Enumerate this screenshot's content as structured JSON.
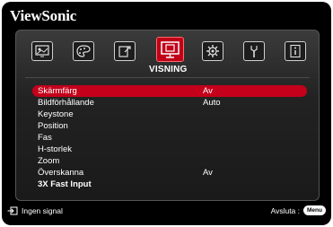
{
  "brand": "ViewSonic",
  "tabs": [
    {
      "name": "tab-display",
      "icon": "display-image-icon"
    },
    {
      "name": "tab-picture",
      "icon": "color-palette-icon"
    },
    {
      "name": "tab-source",
      "icon": "source-input-icon"
    },
    {
      "name": "tab-visning",
      "icon": "projector-screen-icon",
      "active": true,
      "label": "VISNING"
    },
    {
      "name": "tab-settings",
      "icon": "gear-icon"
    },
    {
      "name": "tab-advanced",
      "icon": "tools-icon"
    },
    {
      "name": "tab-info",
      "icon": "info-icon"
    }
  ],
  "active_tab_label": "VISNING",
  "menu": {
    "items": [
      {
        "label": "Skärmfärg",
        "value": "Av",
        "selected": true
      },
      {
        "label": "Bildförhållande",
        "value": "Auto"
      },
      {
        "label": "Keystone",
        "value": ""
      },
      {
        "label": "Position",
        "value": ""
      },
      {
        "label": "Fas",
        "value": ""
      },
      {
        "label": "H-storlek",
        "value": ""
      },
      {
        "label": "Zoom",
        "value": ""
      },
      {
        "label": "Överskanna",
        "value": "Av"
      },
      {
        "label": "3X Fast Input",
        "value": ""
      }
    ]
  },
  "footer": {
    "signal_text": "Ingen signal",
    "exit_text": "Avsluta :",
    "menu_key": "Menu"
  },
  "colors": {
    "highlight": "#c4001a",
    "background": "#000000",
    "text": "#ffffff"
  }
}
